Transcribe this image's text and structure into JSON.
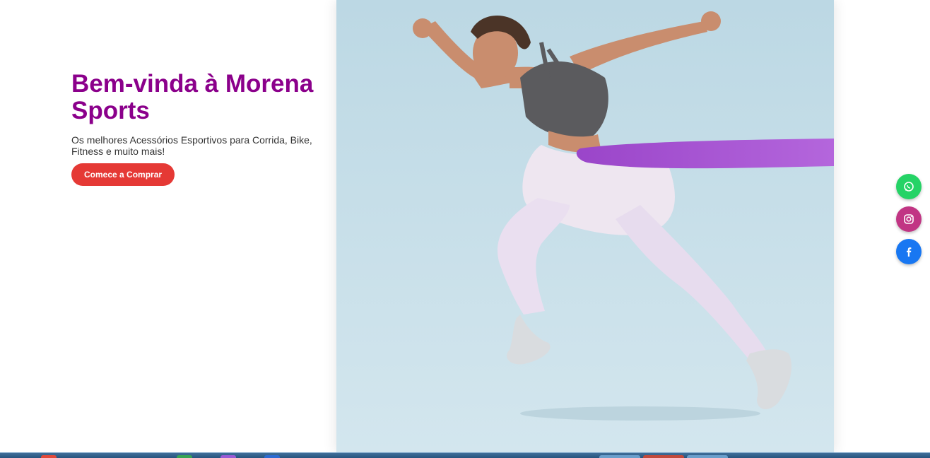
{
  "hero": {
    "title": "Bem-vinda à Morena Sports",
    "subtitle": "Os melhores Acessórios Esportivos para Corrida, Bike, Fitness e muito mais!",
    "cta_label": "Comece a Comprar",
    "image_icon": "athlete-running-photo"
  },
  "colors": {
    "title": "#8b008b",
    "cta": "#e53935",
    "whatsapp": "#25d366",
    "instagram": "#c13584",
    "facebook": "#1877f2",
    "photo_background": "#bcd7e3",
    "resistance_band": "#a24fd0"
  },
  "social": [
    {
      "name": "whatsapp",
      "icon": "whatsapp-icon"
    },
    {
      "name": "instagram",
      "icon": "instagram-icon"
    },
    {
      "name": "facebook",
      "icon": "facebook-icon"
    }
  ],
  "taskbar": {
    "icons": [
      "browser-icon",
      "app-icon",
      "app-icon",
      "app-icon",
      "app-icon",
      "app-icon",
      "app-icon"
    ]
  }
}
